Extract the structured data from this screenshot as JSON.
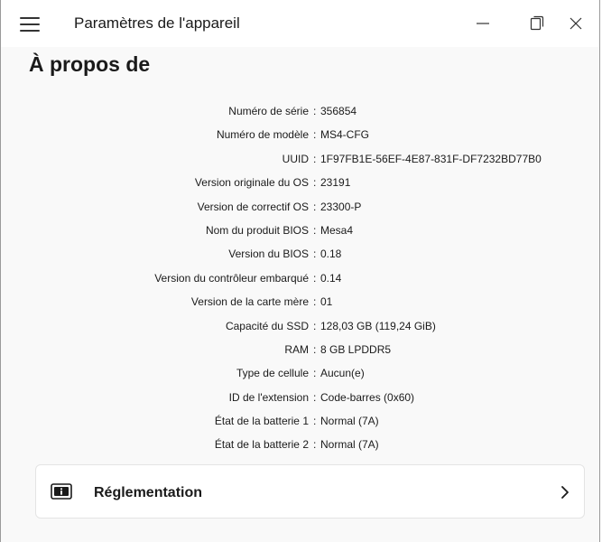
{
  "window": {
    "title": "Paramètres de l'appareil",
    "buttons": {
      "minimize": "minimize-icon",
      "maximize": "maximize-icon",
      "close": "close-icon"
    }
  },
  "page": {
    "title": "À propos de"
  },
  "info": [
    {
      "label": "Numéro de série",
      "value": "356854"
    },
    {
      "label": "Numéro de modèle",
      "value": "MS4-CFG"
    },
    {
      "label": "UUID",
      "value": "1F97FB1E-56EF-4E87-831F-DF7232BD77B0"
    },
    {
      "label": "Version originale du OS",
      "value": "23191"
    },
    {
      "label": "Version de correctif OS",
      "value": "23300-P"
    },
    {
      "label": "Nom du produit BIOS",
      "value": "Mesa4"
    },
    {
      "label": "Version du BIOS",
      "value": "0.18"
    },
    {
      "label": "Version du contrôleur embarqué",
      "value": "0.14"
    },
    {
      "label": "Version de la carte mère",
      "value": "01"
    },
    {
      "label": "Capacité du SSD",
      "value": "128,03 GB (119,24 GiB)"
    },
    {
      "label": "RAM",
      "value": "8 GB LPDDR5"
    },
    {
      "label": "Type de cellule",
      "value": "Aucun(e)"
    },
    {
      "label": "ID de l'extension",
      "value": "Code-barres (0x60)"
    },
    {
      "label": "État de la batterie 1",
      "value": "Normal (7A)"
    },
    {
      "label": "État de la batterie 2",
      "value": "Normal (7A)"
    }
  ],
  "separator": ":",
  "card": {
    "label": "Réglementation",
    "icon": "info-card-icon",
    "chevron": "chevron-right-icon"
  }
}
